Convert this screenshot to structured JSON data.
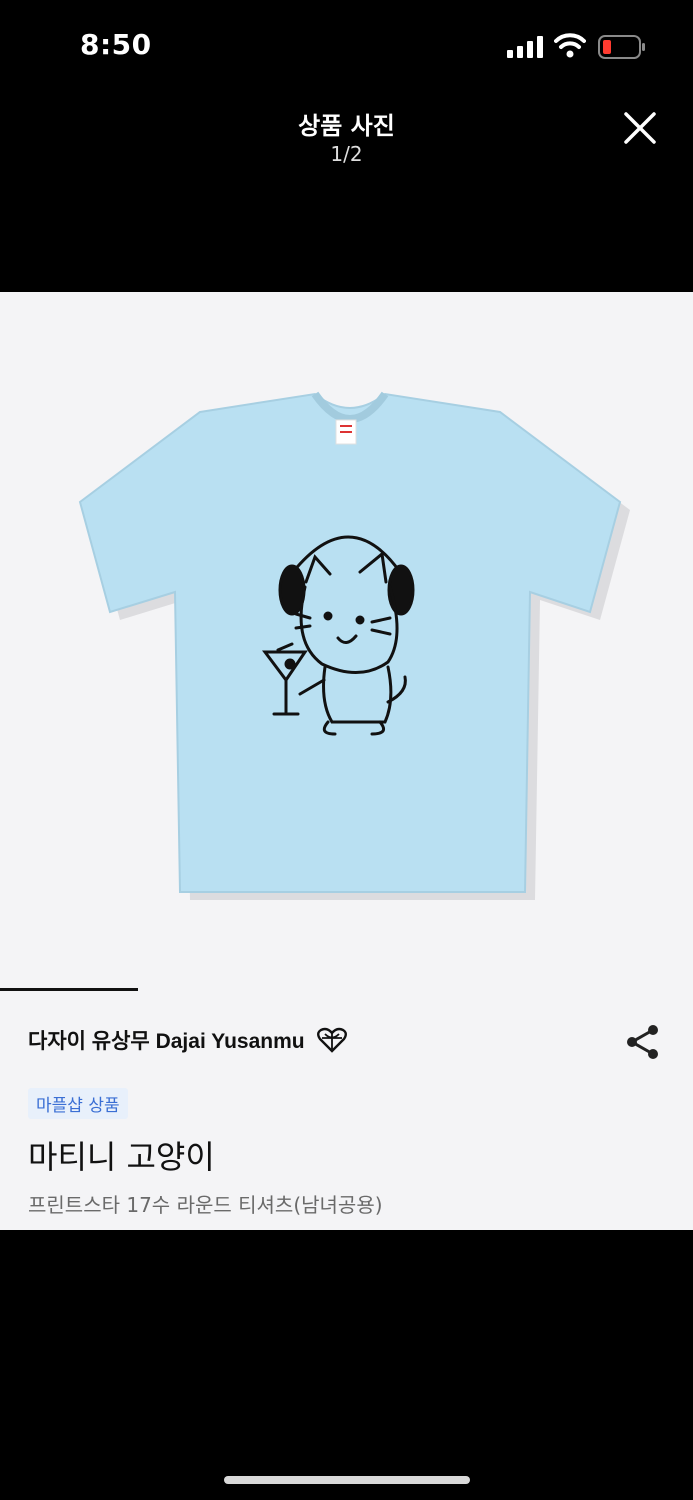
{
  "status_bar": {
    "time": "8:50"
  },
  "header": {
    "title": "상품 사진",
    "counter": "1/2"
  },
  "product": {
    "shop_name": "다자이 유상무 Dajai Yusanmu",
    "badge": "마플샵 상품",
    "title": "마티니 고양이",
    "subtitle": "프린트스타 17수 라운드 티셔츠(남녀공용)",
    "shirt_color": "#b9e0f2"
  },
  "icons": [
    "signal-icon",
    "wifi-icon",
    "battery-icon",
    "close-icon",
    "heart-globe-icon",
    "share-icon"
  ]
}
